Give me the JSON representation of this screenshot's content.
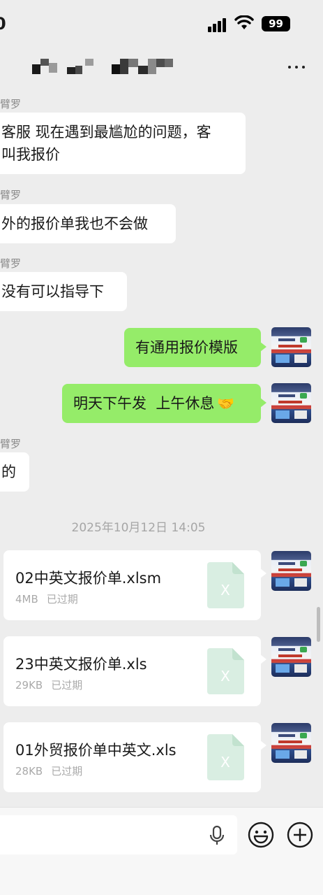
{
  "status_bar": {
    "battery": "99"
  },
  "chat": {
    "messages": [
      {
        "sender": "臂罗",
        "text_line1": "客服 现在遇到最尴尬的问题，客",
        "text_line2": "叫我报价"
      },
      {
        "sender": "臂罗",
        "text": "外的报价单我也不会做"
      },
      {
        "sender": "臂罗",
        "text": "没有可以指导下"
      },
      {
        "sender": "臂罗",
        "text": "的"
      }
    ],
    "outgoing": [
      {
        "text": "有通用报价模版"
      },
      {
        "text": "明天下午发  上午休息",
        "emoji": "handshake"
      }
    ],
    "timestamp": "2025年10月12日 14:05",
    "files": [
      {
        "name": "02中英文报价单.xlsm",
        "size": "4MB",
        "status": "已过期"
      },
      {
        "name": "23中英文报价单.xls",
        "size": "29KB",
        "status": "已过期"
      },
      {
        "name": "01外贸报价单中英文.xls",
        "size": "28KB",
        "status": "已过期"
      }
    ]
  },
  "icons": {
    "file_type": "excel-icon",
    "more": "more-dots-icon",
    "voice": "microphone-icon",
    "emoji": "emoji-icon",
    "plus": "plus-icon"
  },
  "colors": {
    "background": "#ededed",
    "outgoing_bubble": "#95ec69",
    "incoming_bubble": "#ffffff",
    "excel_icon": "#d9eee2"
  }
}
